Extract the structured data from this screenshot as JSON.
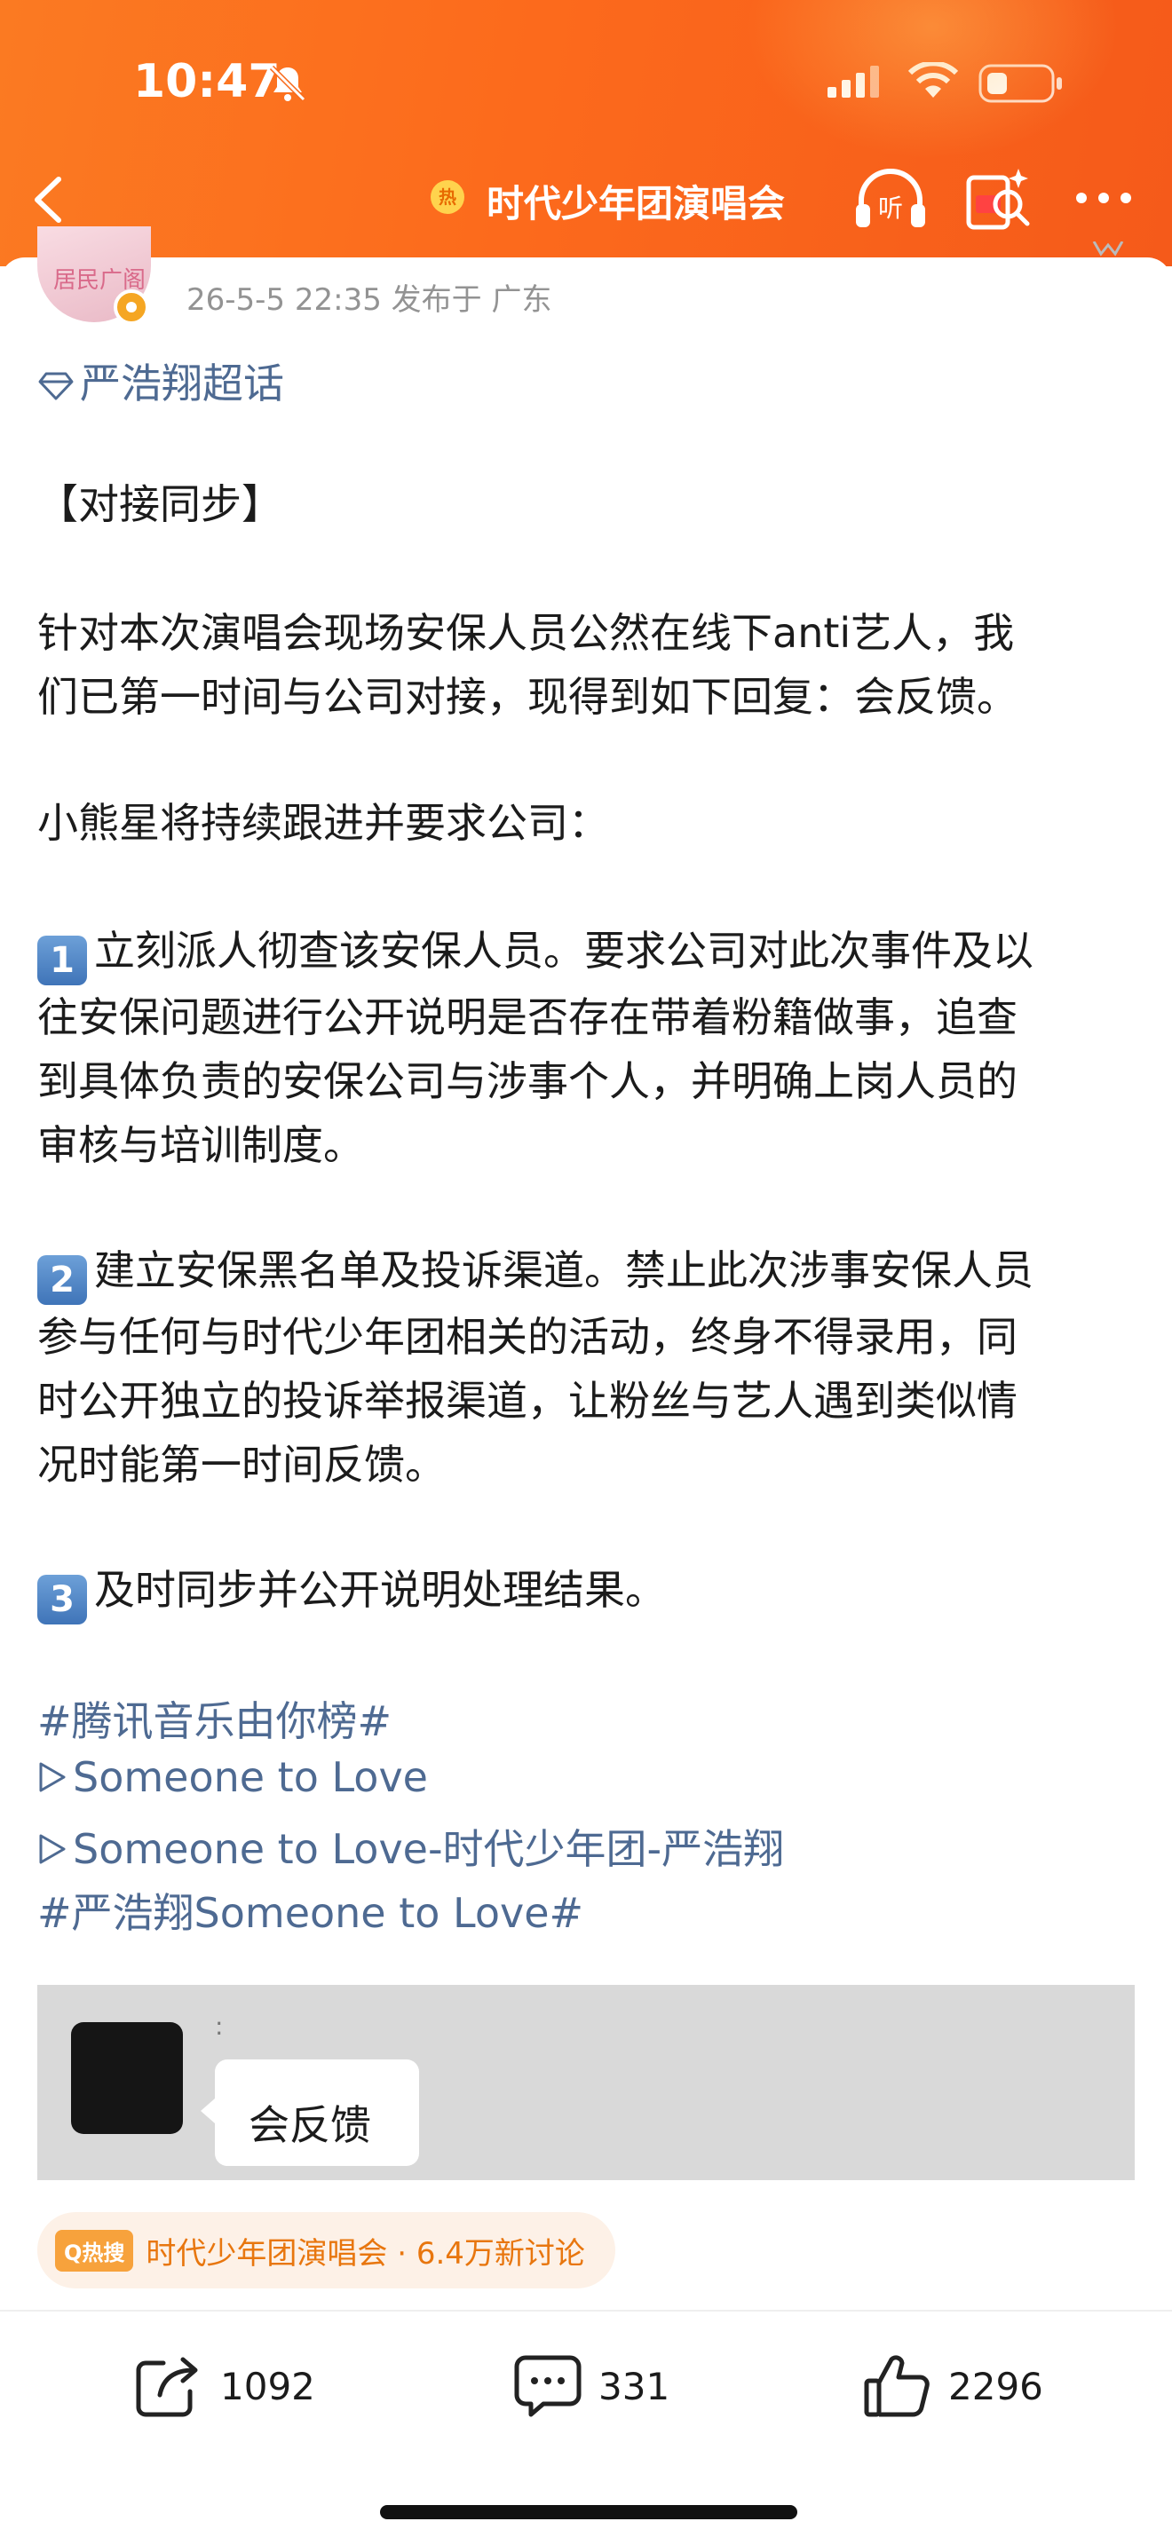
{
  "status_bar": {
    "time": "10:47"
  },
  "nav": {
    "hot_badge": "热",
    "title": "时代少年团演唱会"
  },
  "post": {
    "avatar_text": "居民广阁",
    "meta": "26-5-5 22:35  发布于 广东",
    "topic": "严浩翔超话",
    "heading": "【对接同步】",
    "paragraph1_line1": "针对本次演唱会现场安保人员公然在线下anti艺人，我",
    "paragraph1_line2": "们已第一时间与公司对接，现得到如下回复：会反馈。",
    "paragraph2": "小熊星将持续跟进并要求公司：",
    "items": [
      {
        "num": "1",
        "line1": "立刻派人彻查该安保人员。要求公司对此次事件及以",
        "line2": "往安保问题进行公开说明是否存在带着粉籍做事，追查",
        "line3": "到具体负责的安保公司与涉事个人，并明确上岗人员的",
        "line4": "审核与培训制度。"
      },
      {
        "num": "2",
        "line1": "建立安保黑名单及投诉渠道。禁止此次涉事安保人员",
        "line2": "参与任何与时代少年团相关的活动，终身不得录用，同",
        "line3": "时公开独立的投诉举报渠道，让粉丝与艺人遇到类似情",
        "line4": "况时能第一时间反馈。"
      },
      {
        "num": "3",
        "line1": "及时同步并公开说明处理结果。"
      }
    ],
    "tags": [
      "#腾讯音乐由你榜#",
      "Someone to Love",
      "Someone to Love-时代少年团-严浩翔",
      "#严浩翔Someone to Love#"
    ],
    "image": {
      "colon": ":",
      "bubble_text": "会反馈"
    },
    "hot_search": {
      "tag": "Q热搜",
      "text": "时代少年团演唱会 · 6.4万新讨论"
    }
  },
  "actions": {
    "repost_count": "1092",
    "comment_count": "331",
    "like_count": "2296"
  },
  "colors": {
    "header_orange": "#fb7a22",
    "link_blue": "#4e6a92",
    "hot_orange": "#e8760e"
  }
}
